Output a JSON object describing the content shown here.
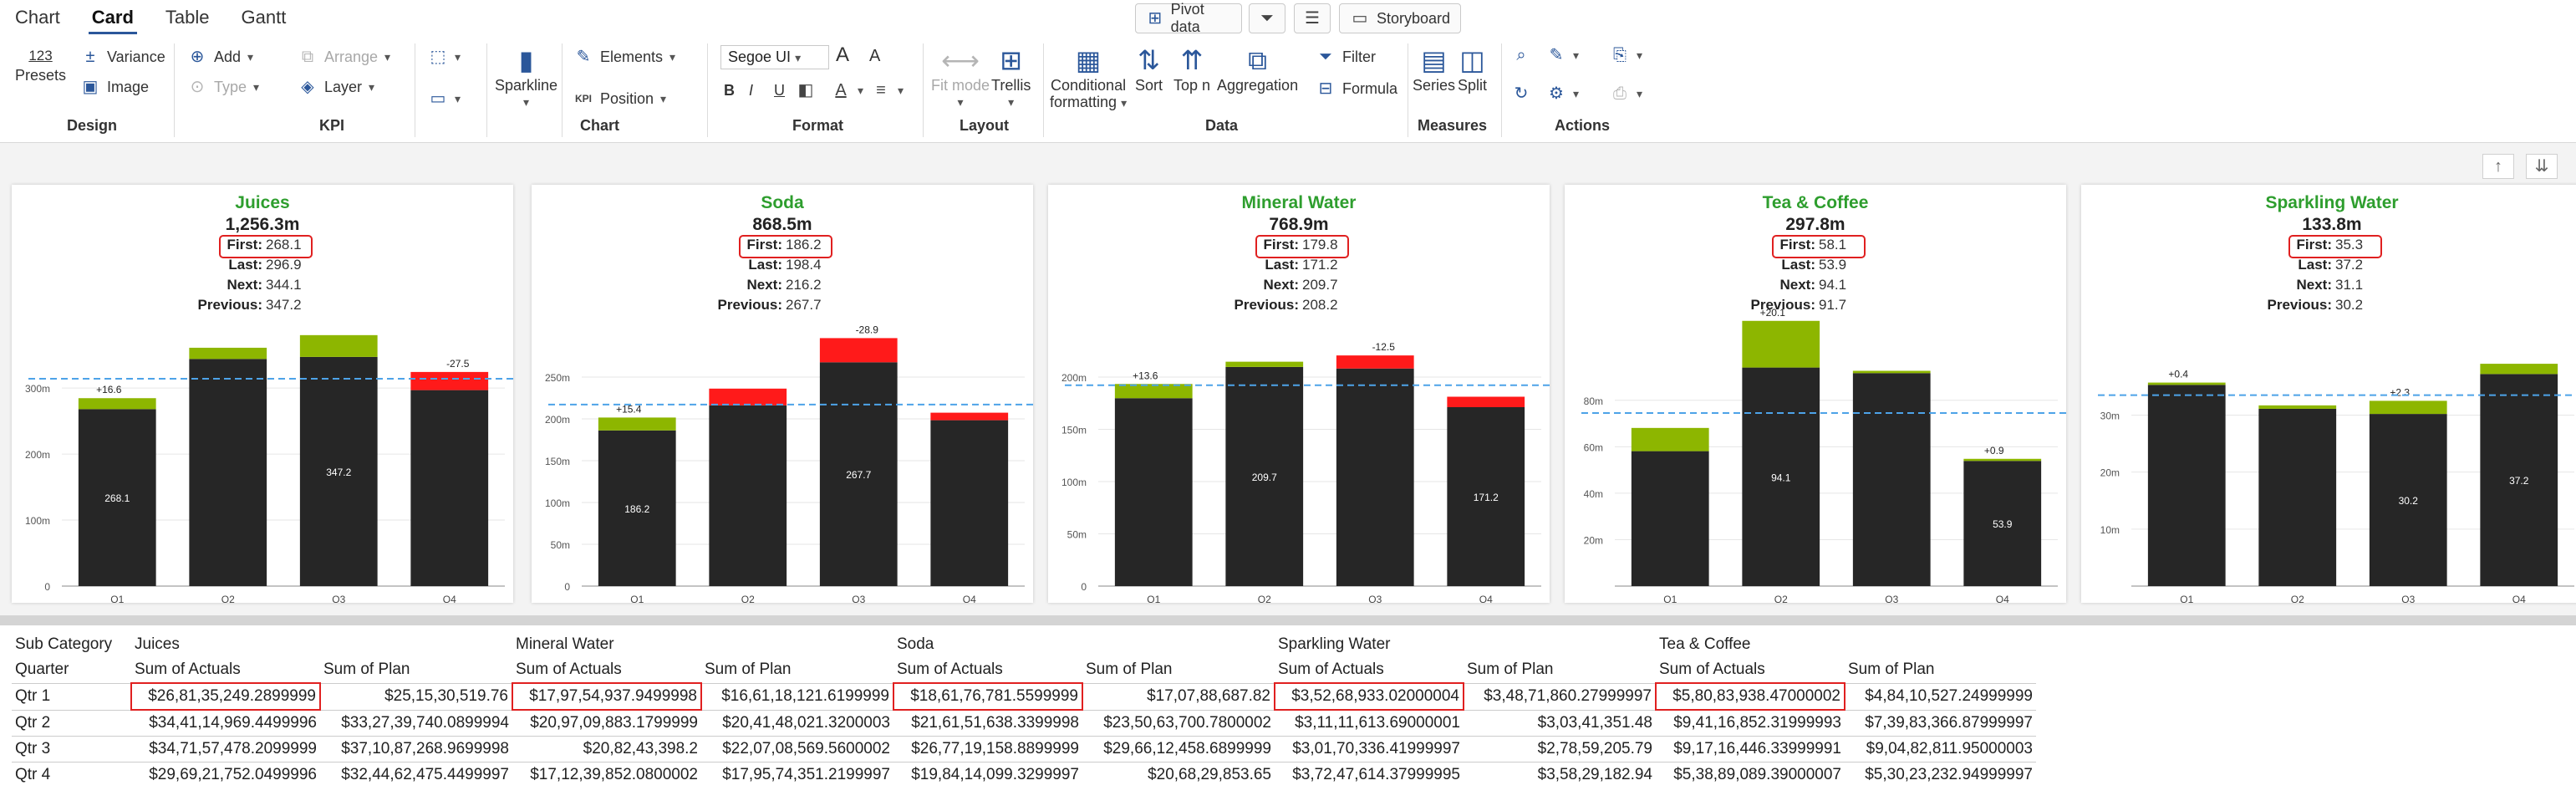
{
  "ribbon": {
    "tabs": [
      "Chart",
      "Card",
      "Table",
      "Gantt"
    ],
    "active_tab": "Card",
    "top_buttons": {
      "pivot": "Pivot data",
      "storyboard": "Storyboard"
    },
    "design": {
      "presets_value": "123",
      "presets": "Presets",
      "variance": "Variance",
      "image": "Image",
      "group": "Design"
    },
    "kpi": {
      "add": "Add",
      "type": "Type",
      "arrange": "Arrange",
      "layer": "Layer",
      "group": "KPI"
    },
    "chart": {
      "sparkline": "Sparkline",
      "elements": "Elements",
      "position": "Position",
      "kpi_badge": "KPI",
      "group": "Chart"
    },
    "format": {
      "font": "Segoe UI",
      "bold": "B",
      "italic": "I",
      "underline": "U",
      "group": "Format"
    },
    "layout": {
      "fit_mode": "Fit mode",
      "trellis": "Trellis",
      "group": "Layout"
    },
    "data": {
      "conditional": "Conditional",
      "formatting": "formatting",
      "sort": "Sort",
      "topn": "Top n",
      "aggregation": "Aggregation",
      "filter": "Filter",
      "formula": "Formula",
      "group": "Data"
    },
    "measures": {
      "series": "Series",
      "split": "Split",
      "group": "Measures"
    },
    "actions": {
      "group": "Actions"
    }
  },
  "colors": {
    "accent": "#2b579a",
    "title_green": "#2e9e2e",
    "bar": "#262626",
    "pos": "#8db600",
    "neg": "#ff1a1a",
    "avg_line": "#4da3e8",
    "highlight": "#e02020"
  },
  "kpi_labels": {
    "first": "First:",
    "last": "Last:",
    "next": "Next:",
    "previous": "Previous:"
  },
  "cards": [
    {
      "title": "Juices",
      "total": "1,256.3m",
      "first": "268.1",
      "last": "296.9",
      "next": "344.1",
      "previous": "347.2",
      "chart_data": {
        "type": "bar",
        "categories": [
          "Q1",
          "Q2",
          "Q3",
          "Q4"
        ],
        "values": [
          268.1,
          344.1,
          347.2,
          296.9
        ],
        "deltas": [
          16.6,
          17.0,
          33.0,
          -27.5
        ],
        "delta_labels": [
          "+16.6",
          "",
          "",
          "-27.5"
        ],
        "bar_labels": [
          "268.1",
          "",
          "347.2",
          ""
        ],
        "yticks": [
          0,
          100,
          200,
          300
        ],
        "ytick_labels": [
          "0",
          "100m",
          "200m",
          "300m"
        ],
        "ymax": 380,
        "average": 314.1
      }
    },
    {
      "title": "Soda",
      "total": "868.5m",
      "first": "186.2",
      "last": "198.4",
      "next": "216.2",
      "previous": "267.7",
      "chart_data": {
        "type": "bar",
        "categories": [
          "Q1",
          "Q2",
          "Q3",
          "Q4"
        ],
        "values": [
          186.2,
          216.2,
          267.7,
          198.4
        ],
        "deltas": [
          15.4,
          -20.0,
          -28.9,
          -9.0
        ],
        "delta_labels": [
          "+15.4",
          "",
          "-28.9",
          ""
        ],
        "bar_labels": [
          "186.2",
          "",
          "267.7",
          ""
        ],
        "yticks": [
          0,
          50,
          100,
          150,
          200,
          250
        ],
        "ytick_labels": [
          "0",
          "50m",
          "100m",
          "150m",
          "200m",
          "250m"
        ],
        "ymax": 300,
        "average": 217.1
      }
    },
    {
      "title": "Mineral Water",
      "total": "768.9m",
      "first": "179.8",
      "last": "171.2",
      "next": "209.7",
      "previous": "208.2",
      "chart_data": {
        "type": "bar",
        "categories": [
          "Q1",
          "Q2",
          "Q3",
          "Q4"
        ],
        "values": [
          179.8,
          209.7,
          208.2,
          171.2
        ],
        "deltas": [
          13.6,
          5.0,
          -12.5,
          -10.0
        ],
        "delta_labels": [
          "+13.6",
          "",
          "-12.5",
          ""
        ],
        "bar_labels": [
          "",
          "209.7",
          "",
          "171.2"
        ],
        "yticks": [
          0,
          50,
          100,
          150,
          200
        ],
        "ytick_labels": [
          "0",
          "50m",
          "100m",
          "150m",
          "200m"
        ],
        "ymax": 240,
        "average": 192.2
      }
    },
    {
      "title": "Tea & Coffee",
      "total": "297.8m",
      "first": "58.1",
      "last": "53.9",
      "next": "94.1",
      "previous": "91.7",
      "chart_data": {
        "type": "bar",
        "categories": [
          "Q1",
          "Q2",
          "Q3",
          "Q4"
        ],
        "values": [
          58.1,
          94.1,
          91.7,
          53.9
        ],
        "deltas": [
          10.0,
          20.1,
          1.0,
          0.9
        ],
        "delta_labels": [
          "",
          "+20.1",
          "",
          "+0.9"
        ],
        "bar_labels": [
          "",
          "94.1",
          "",
          "53.9"
        ],
        "yticks": [
          20,
          40,
          60,
          80
        ],
        "ytick_labels": [
          "20m",
          "40m",
          "60m",
          "80m"
        ],
        "ymax": 108,
        "average": 74.5
      }
    },
    {
      "title": "Sparkling Water",
      "total": "133.8m",
      "first": "35.3",
      "last": "37.2",
      "next": "31.1",
      "previous": "30.2",
      "chart_data": {
        "type": "bar",
        "categories": [
          "Q1",
          "Q2",
          "Q3",
          "Q4"
        ],
        "values": [
          35.3,
          31.1,
          30.2,
          37.2
        ],
        "deltas": [
          0.4,
          0.6,
          2.3,
          1.8
        ],
        "delta_labels": [
          "+0.4",
          "",
          "+2.3",
          ""
        ],
        "bar_labels": [
          "",
          "",
          "30.2",
          "37.2"
        ],
        "yticks": [
          10,
          20,
          30
        ],
        "ytick_labels": [
          "10m",
          "20m",
          "30m"
        ],
        "ymax": 44,
        "average": 33.5
      }
    }
  ],
  "table": {
    "h1": [
      "Sub Category",
      "Juices",
      "",
      "Mineral Water",
      "",
      "Soda",
      "",
      "Sparkling Water",
      "",
      "Tea & Coffee",
      ""
    ],
    "h2": [
      "Quarter",
      "Sum of Actuals",
      "Sum of Plan",
      "Sum of Actuals",
      "Sum of Plan",
      "Sum of Actuals",
      "Sum of Plan",
      "Sum of Actuals",
      "Sum of Plan",
      "Sum of Actuals",
      "Sum of Plan"
    ],
    "rows": [
      [
        "Qtr 1",
        "$26,81,35,249.2899999",
        "$25,15,30,519.76",
        "$17,97,54,937.9499998",
        "$16,61,18,121.6199999",
        "$18,61,76,781.5599999",
        "$17,07,88,687.82",
        "$3,52,68,933.02000004",
        "$3,48,71,860.27999997",
        "$5,80,83,938.47000002",
        "$4,84,10,527.24999999"
      ],
      [
        "Qtr 2",
        "$34,41,14,969.4499996",
        "$33,27,39,740.0899994",
        "$20,97,09,883.1799999",
        "$20,41,48,021.3200003",
        "$21,61,51,638.3399998",
        "$23,50,63,700.7800002",
        "$3,11,11,613.69000001",
        "$3,03,41,351.48",
        "$9,41,16,852.31999993",
        "$7,39,83,366.87999997"
      ],
      [
        "Qtr 3",
        "$34,71,57,478.2099999",
        "$37,10,87,268.9699998",
        "$20,82,43,398.2",
        "$22,07,08,569.5600002",
        "$26,77,19,158.8899999",
        "$29,66,12,458.6899999",
        "$3,01,70,336.41999997",
        "$2,78,59,205.79",
        "$9,17,16,446.33999991",
        "$9,04,82,811.95000003"
      ],
      [
        "Qtr 4",
        "$29,69,21,752.0499996",
        "$32,44,62,475.4499997",
        "$17,12,39,852.0800002",
        "$17,95,74,351.2199997",
        "$19,84,14,099.3299997",
        "$20,68,29,853.65",
        "$3,72,47,614.37999995",
        "$3,58,29,182.94",
        "$5,38,89,089.39000007",
        "$5,30,23,232.94999997"
      ]
    ]
  }
}
